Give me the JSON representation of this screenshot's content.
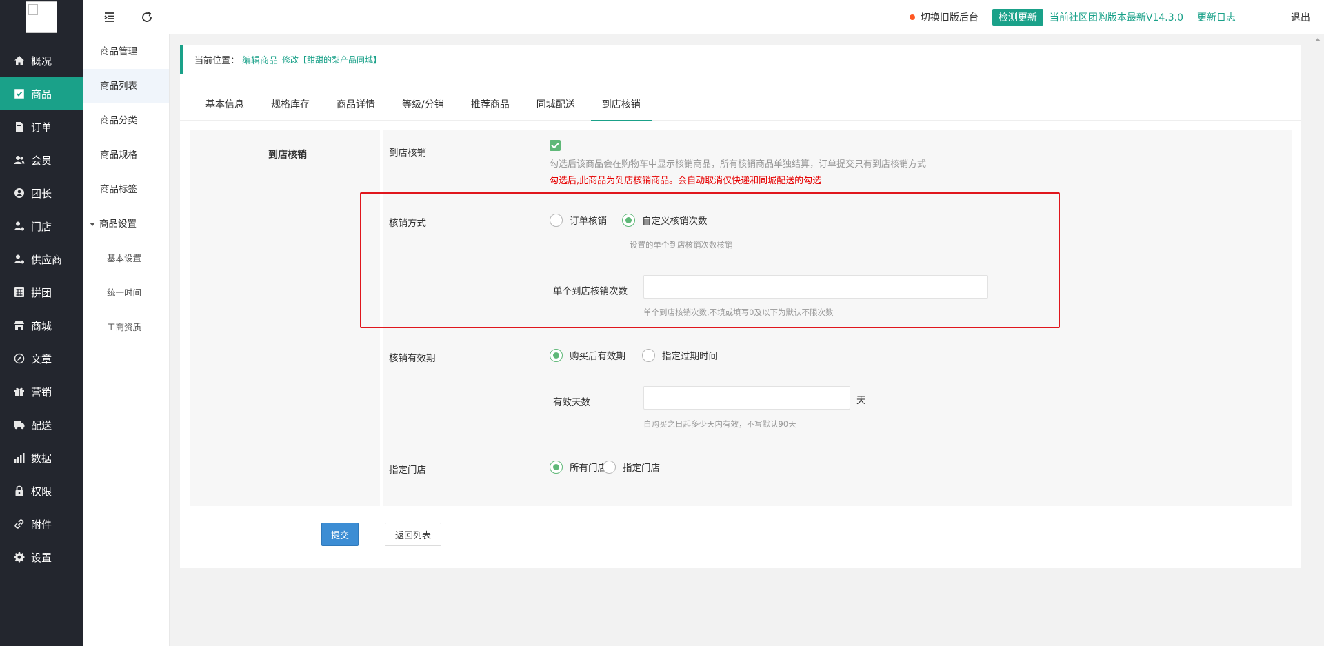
{
  "sidebar": {
    "items": [
      {
        "label": "概况",
        "icon": "home-icon"
      },
      {
        "label": "商品",
        "icon": "product-icon",
        "active": true
      },
      {
        "label": "订单",
        "icon": "order-icon"
      },
      {
        "label": "会员",
        "icon": "member-icon"
      },
      {
        "label": "团长",
        "icon": "leader-icon"
      },
      {
        "label": "门店",
        "icon": "store-icon"
      },
      {
        "label": "供应商",
        "icon": "supplier-icon"
      },
      {
        "label": "拼团",
        "icon": "group-buy-icon"
      },
      {
        "label": "商城",
        "icon": "mall-icon"
      },
      {
        "label": "文章",
        "icon": "article-icon"
      },
      {
        "label": "营销",
        "icon": "marketing-icon"
      },
      {
        "label": "配送",
        "icon": "delivery-icon"
      },
      {
        "label": "数据",
        "icon": "data-icon"
      },
      {
        "label": "权限",
        "icon": "lock-icon"
      },
      {
        "label": "附件",
        "icon": "attachment-icon"
      },
      {
        "label": "设置",
        "icon": "gear-icon"
      }
    ]
  },
  "subnav": {
    "header": "商品管理",
    "items": [
      "商品列表",
      "商品分类",
      "商品规格",
      "商品标签"
    ],
    "group": "商品设置",
    "children": [
      "基本设置",
      "统一时间",
      "工商资质"
    ]
  },
  "header": {
    "old_backend": "切换旧版后台",
    "detect_update": "检测更新",
    "version_text": "当前社区团购版本最新V14.3.0",
    "changelog": "更新日志",
    "logout": "退出",
    "accent": "#1aa189"
  },
  "breadcrumb": {
    "prefix": "当前位置：",
    "page": "编辑商品",
    "action": "修改【甜甜的梨产品同城】"
  },
  "tabs": [
    "基本信息",
    "规格库存",
    "商品详情",
    "等级/分销",
    "推荐商品",
    "同城配送",
    "到店核销"
  ],
  "form": {
    "section_title": "到店核销",
    "store_verify": {
      "label": "到店核销",
      "checked": true,
      "hint": "勾选后该商品会在购物车中显示核销商品，所有核销商品单独结算，订单提交只有到店核销方式",
      "warning": "勾选后,此商品为到店核销商品。会自动取消仅快递和同城配送的勾选"
    },
    "verify_method": {
      "label": "核销方式",
      "options": [
        "订单核销",
        "自定义核销次数"
      ],
      "selected": "自定义核销次数",
      "hint": "设置的单个到店核销次数核销",
      "count_label": "单个到店核销次数",
      "count_value": "",
      "count_hint": "单个到店核销次数,不填或填写0及以下为默认不限次数"
    },
    "validity": {
      "label": "核销有效期",
      "options": [
        "购买后有效期",
        "指定过期时间"
      ],
      "selected": "购买后有效期",
      "days_label": "有效天数",
      "days_value": "",
      "unit": "天",
      "days_hint": "自购买之日起多少天内有效，不写默认90天"
    },
    "stores": {
      "label": "指定门店",
      "options": [
        "所有门店",
        "指定门店"
      ],
      "selected": "所有门店"
    }
  },
  "buttons": {
    "submit": "提交",
    "back": "返回列表"
  }
}
